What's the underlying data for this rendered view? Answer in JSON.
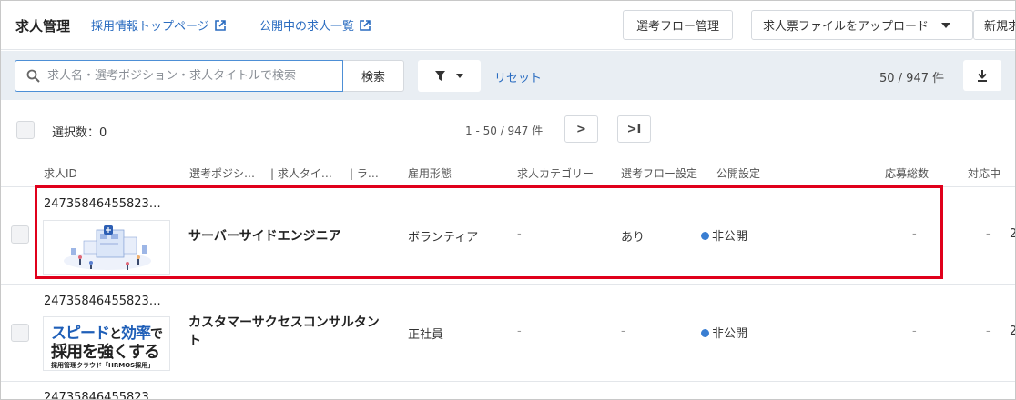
{
  "header": {
    "title": "求人管理",
    "link_top": "採用情報トップページ",
    "link_open_jobs": "公開中の求人一覧",
    "flow_button": "選考フロー管理",
    "upload_button": "求人票ファイルをアップロード",
    "new_button": "新規求"
  },
  "toolbar": {
    "search_placeholder": "求人名・選考ポジション・求人タイトルで検索",
    "search_button": "検索",
    "reset": "リセット",
    "count": "50 / 947 件"
  },
  "selection": {
    "label": "選択数：0",
    "pager": "1 - 50 / 947 件",
    "next": ">",
    "last": ">I"
  },
  "columns": {
    "job_id": "求人ID",
    "position": "選考ポジシ…",
    "job_title": "| 求人タイ…",
    "label": "| ラ…",
    "employment": "雇用形態",
    "category": "求人カテゴリー",
    "flow": "選考フロー設定",
    "publish": "公開設定",
    "applications": "応募総数",
    "in_progress": "対応中"
  },
  "rows": [
    {
      "id": "24735846455823…",
      "title": "サーバーサイドエンジニア",
      "employment": "ボランティア",
      "category": "-",
      "flow": "あり",
      "publish": "非公開",
      "applications": "-",
      "in_progress": "-",
      "overflow": "2"
    },
    {
      "id": "24735846455823…",
      "title": "カスタマーサクセスコンサルタント",
      "employment": "正社員",
      "category": "-",
      "flow": "-",
      "publish": "非公開",
      "applications": "-",
      "in_progress": "-",
      "overflow": "2",
      "banner": {
        "a": "スピード",
        "b": "と",
        "c": "効率",
        "d": "で",
        "line2": "採用を強くする",
        "line3": "採用管理クラウド「HRMOS採用」"
      }
    },
    {
      "id": "24735846455823…"
    }
  ],
  "colors": {
    "accent": "#2a6cc0",
    "highlight": "#e0001b",
    "toolbar_bg": "#e9eef3"
  }
}
